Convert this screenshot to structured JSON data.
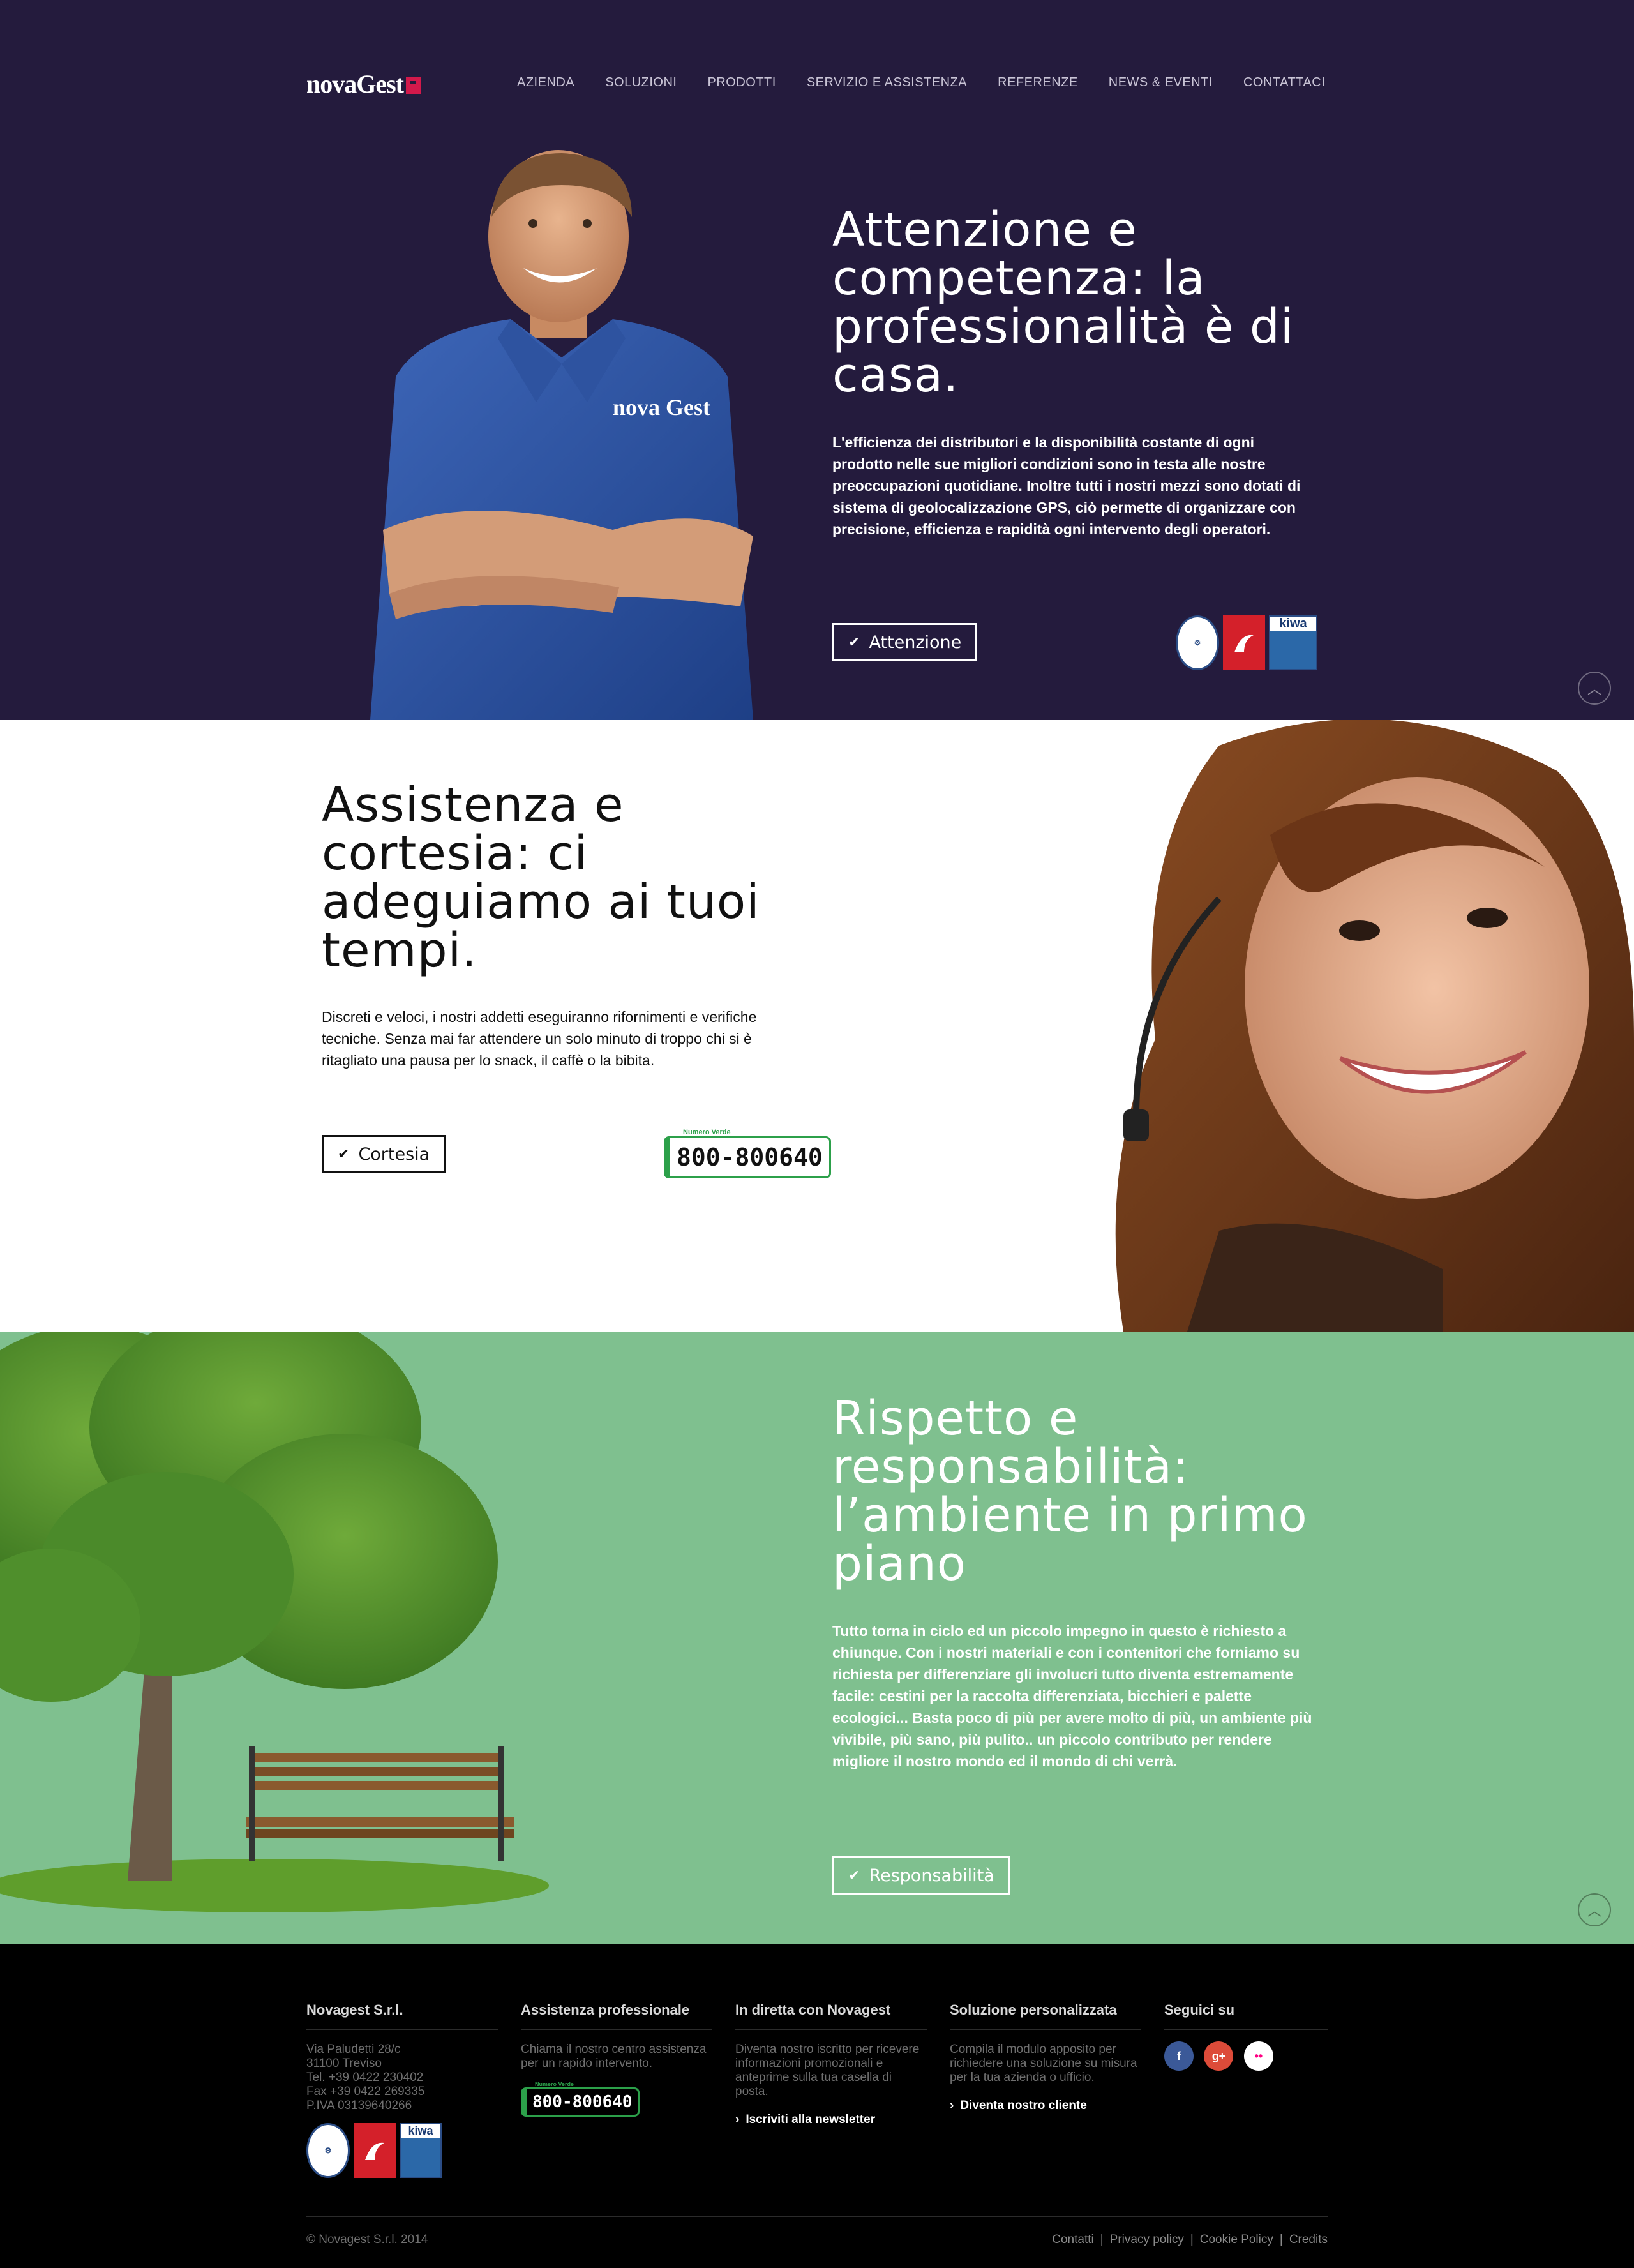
{
  "header": {
    "logo": "novaGest",
    "nav": [
      "AZIENDA",
      "SOLUZIONI",
      "PRODOTTI",
      "SERVIZIO E ASSISTENZA",
      "REFERENZE",
      "NEWS & EVENTI",
      "CONTATTACI"
    ]
  },
  "section_attenzione": {
    "title": "Attenzione e competenza: la professionalità è di casa.",
    "text": "L'efficienza dei distributori e la disponibilità costante di ogni prodotto nelle sue migliori condizioni sono in testa alle nostre preoccupazioni quotidiane. Inoltre tutti i nostri mezzi sono dotati di sistema di geolocalizzazione GPS, ciò permette di organizzare con precisione, efficienza e rapidità ogni intervento degli operatori.",
    "button": "Attenzione",
    "shirt_logo": "nova Gest",
    "cert_kiwa": "kiwa"
  },
  "section_cortesia": {
    "title": "Assistenza e cortesia: ci adeguiamo ai tuoi tempi.",
    "text": "Discreti e veloci, i nostri addetti eseguiranno rifornimenti e verifiche tecniche. Senza mai far attendere un solo minuto di troppo chi si è ritagliato una pausa per lo snack, il caffè o la bibita.",
    "button": "Cortesia",
    "numero_verde_label": "Numero Verde",
    "numero_verde": "800-800640"
  },
  "section_rispetto": {
    "title": "Rispetto e responsabilità: l’ambiente in primo piano",
    "text": "Tutto torna in ciclo ed un piccolo impegno in questo è richiesto a chiunque. Con i nostri materiali e con i contenitori che forniamo su richiesta per differenziare gli involucri tutto diventa estremamente facile: cestini per la raccolta differenziata, bicchieri e palette ecologici... Basta poco di più per avere molto di più, un ambiente più vivibile, più sano, più pulito.. un piccolo contributo per rendere migliore il nostro mondo ed il mondo di chi verrà.",
    "button": "Responsabilità"
  },
  "footer": {
    "col1": {
      "title": "Novagest S.r.l.",
      "lines": [
        "Via Paludetti 28/c",
        "31100 Treviso",
        "Tel. +39 0422 230402",
        "Fax +39 0422 269335",
        "P.IVA 03139640266"
      ]
    },
    "col2": {
      "title": "Assistenza professionale",
      "text": "Chiama il nostro centro assistenza per un rapido intervento.",
      "numero_verde_label": "Numero Verde",
      "numero_verde": "800-800640"
    },
    "col3": {
      "title": "In diretta con Novagest",
      "text": "Diventa nostro iscritto per ricevere informazioni promozionali e anteprime sulla tua casella di posta.",
      "link": "Iscriviti alla newsletter"
    },
    "col4": {
      "title": "Soluzione personalizzata",
      "text": "Compila il modulo apposito per richiedere una soluzione su misura per la tua azienda o ufficio.",
      "link": "Diventa nostro cliente"
    },
    "col5": {
      "title": "Seguici su",
      "social": [
        "f",
        "g+",
        "••"
      ]
    },
    "copyright": "© Novagest S.r.l. 2014",
    "legal": [
      "Contatti",
      "Privacy policy",
      "Cookie Policy",
      "Credits"
    ]
  },
  "colors": {
    "hero_bg": "#241b3d",
    "green_bg": "#7fc08f",
    "accent": "#d3194b",
    "footer_bg": "#000000"
  }
}
